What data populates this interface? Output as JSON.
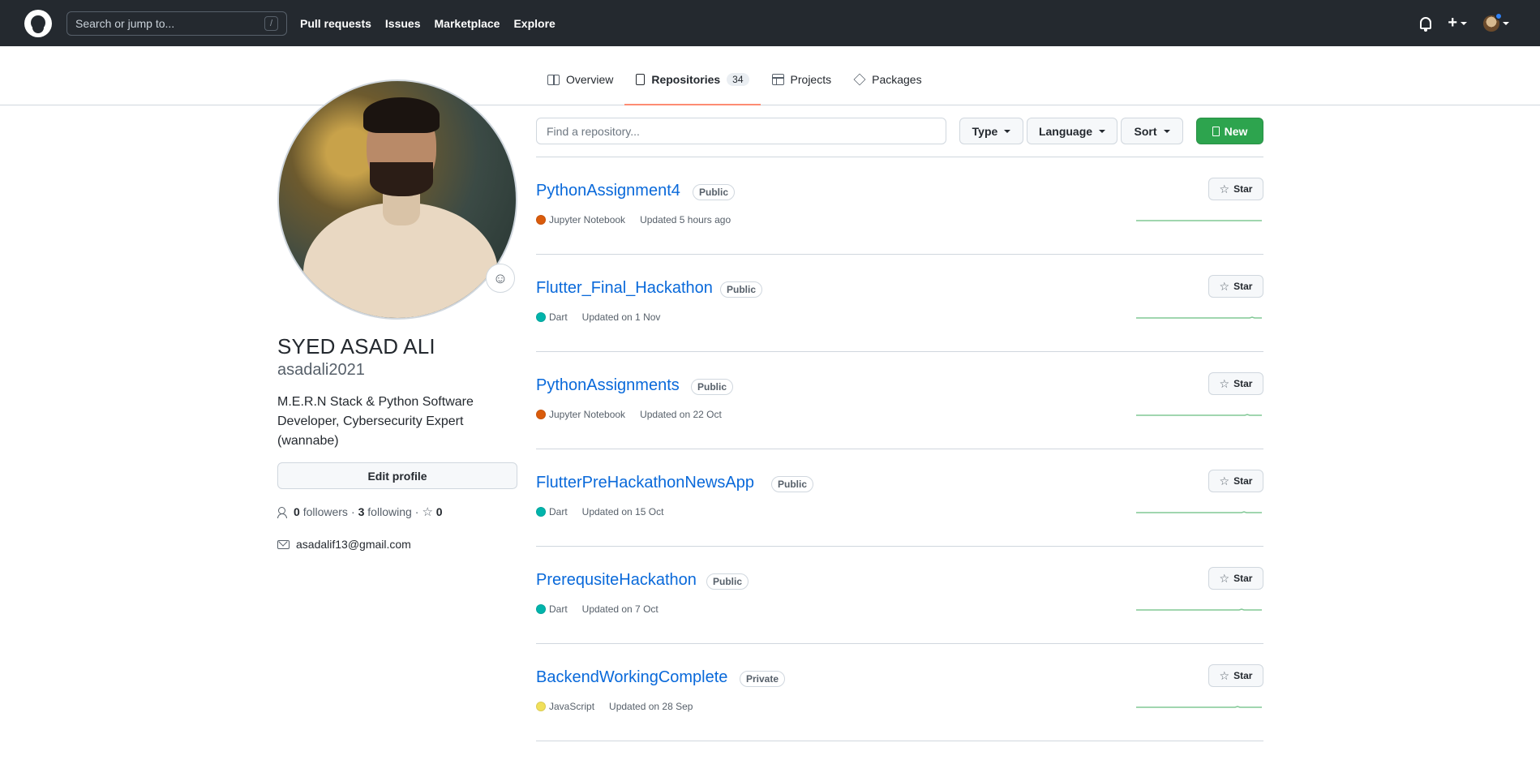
{
  "header": {
    "search_placeholder": "Search or jump to...",
    "search_key": "/",
    "nav": [
      "Pull requests",
      "Issues",
      "Marketplace",
      "Explore"
    ],
    "plus_label": "+"
  },
  "tabs": [
    {
      "label": "Overview"
    },
    {
      "label": "Repositories",
      "count": "34",
      "active": true
    },
    {
      "label": "Projects"
    },
    {
      "label": "Packages"
    }
  ],
  "profile": {
    "full_name": "SYED ASAD ALI",
    "username": "asadali2021",
    "bio": "M.E.R.N Stack & Python Software Developer, Cybersecurity Expert (wannabe)",
    "edit_label": "Edit profile",
    "followers_count": "0",
    "followers_label": "followers",
    "sep": "·",
    "following_count": "3",
    "following_label": "following",
    "stars_count": "0",
    "email": "asadalif13@gmail.com"
  },
  "filters": {
    "find_placeholder": "Find a repository...",
    "type_label": "Type",
    "language_label": "Language",
    "sort_label": "Sort",
    "new_label": "New"
  },
  "repos": [
    {
      "name": "PythonAssignment4",
      "visibility": "Public",
      "language": "Jupyter Notebook",
      "lang_color": "#DA5B0B",
      "updated": "Updated 5 hours ago",
      "star_label": "Star"
    },
    {
      "name": "Flutter_Final_Hackathon",
      "visibility": "Public",
      "language": "Dart",
      "lang_color": "#00B4AB",
      "updated": "Updated on 1 Nov",
      "star_label": "Star"
    },
    {
      "name": "PythonAssignments",
      "visibility": "Public",
      "language": "Jupyter Notebook",
      "lang_color": "#DA5B0B",
      "updated": "Updated on 22 Oct",
      "star_label": "Star"
    },
    {
      "name": "FlutterPreHackathonNewsApp",
      "visibility": "Public",
      "language": "Dart",
      "lang_color": "#00B4AB",
      "updated": "Updated on 15 Oct",
      "star_label": "Star"
    },
    {
      "name": "PrerequsiteHackathon",
      "visibility": "Public",
      "language": "Dart",
      "lang_color": "#00B4AB",
      "updated": "Updated on 7 Oct",
      "star_label": "Star"
    },
    {
      "name": "BackendWorkingComplete",
      "visibility": "Private",
      "language": "JavaScript",
      "lang_color": "#F1E05A",
      "updated": "Updated on 28 Sep",
      "star_label": "Star"
    }
  ],
  "colors": {
    "header_bg": "#24292f",
    "link": "#0969da",
    "new_button": "#2da44e",
    "tab_underline": "#fd8c73",
    "sparkline": "#2da44e"
  }
}
